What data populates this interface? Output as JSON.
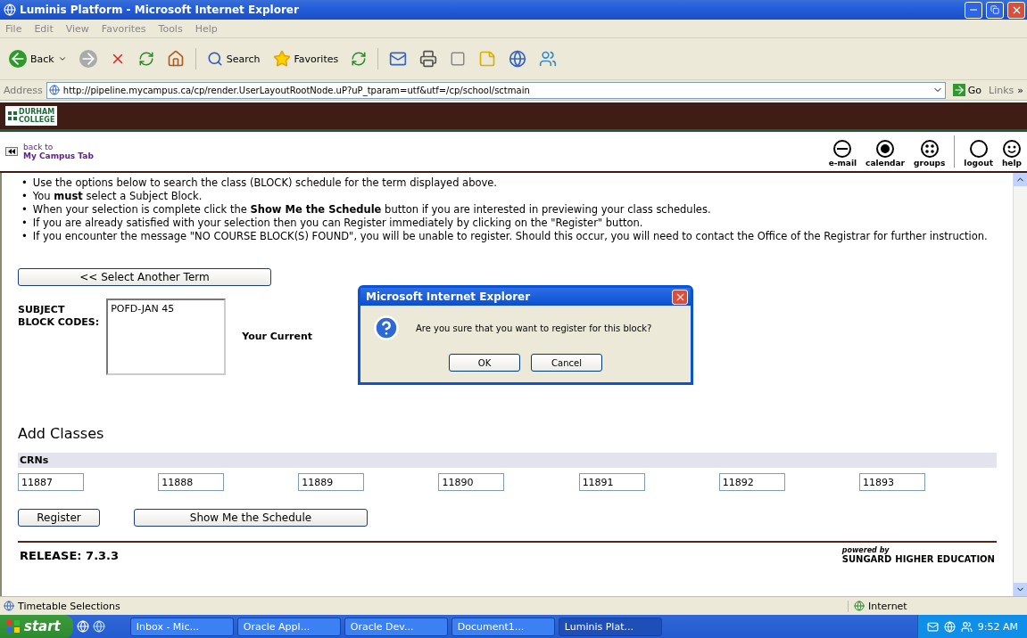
{
  "window": {
    "title": "Luminis Platform - Microsoft Internet Explorer"
  },
  "menu": [
    "File",
    "Edit",
    "View",
    "Favorites",
    "Tools",
    "Help"
  ],
  "toolbar": {
    "back": "Back",
    "search": "Search",
    "favorites": "Favorites"
  },
  "address": {
    "label": "Address",
    "url": "http://pipeline.mycampus.ca/cp/render.UserLayoutRootNode.uP?uP_tparam=utf&utf=/cp/school/sctmain",
    "go": "Go",
    "links": "Links",
    "more": "»"
  },
  "brand": {
    "logo_lines": [
      "DURHAM",
      "COLLEGE"
    ]
  },
  "portal_nav": {
    "back_line1": "back to",
    "back_line2": "My Campus Tab",
    "icons": [
      {
        "kind": "email",
        "label": "e-mail"
      },
      {
        "kind": "calendar",
        "label": "calendar"
      },
      {
        "kind": "groups",
        "label": "groups"
      },
      {
        "kind": "logout",
        "label": "logout"
      },
      {
        "kind": "help",
        "label": "help"
      }
    ]
  },
  "instruction_marker": "•",
  "instructions": [
    "Use the options below to search the class (BLOCK) schedule for the term displayed above.",
    "You **must** select a Subject Block.",
    "When your selection is complete click the **Show Me the Schedule** button if you are interested in previewing your class schedules.",
    "If you are already satisfied with your selection then you can Register immediately by clicking on the \"Register\" button.",
    "If you encounter the message \"NO COURSE BLOCK(S) FOUND\", you will be unable to register. Should this occur, you will need to contact the Office of the Registrar for further instruction."
  ],
  "select_term_button": "<< Select Another Term",
  "subject": {
    "label_line1": "SUBJECT",
    "label_line2": "BLOCK CODES:",
    "options": [
      {
        "label": "POFD-JAN 45",
        "selected": false
      }
    ],
    "current_label": "Your Current"
  },
  "add_classes": {
    "title": "Add Classes",
    "header": "CRNs",
    "crns": [
      "11887",
      "11888",
      "11889",
      "11890",
      "11891",
      "11892",
      "11893"
    ]
  },
  "buttons": {
    "register": "Register",
    "schedule": "Show Me the Schedule"
  },
  "footer": {
    "release": "RELEASE: 7.3.3",
    "powered_by": "powered by",
    "brand": "SUNGARD",
    "brand_suffix": "HIGHER EDUCATION"
  },
  "dialog": {
    "title": "Microsoft Internet Explorer",
    "message": "Are you sure that you want to register for this block?",
    "buttons": [
      "OK",
      "Cancel"
    ]
  },
  "status_bar": {
    "text": "Timetable Selections",
    "zone": "Internet"
  },
  "taskbar": {
    "start": "start",
    "tasks": [
      {
        "label": "Inbox - Mic...",
        "selected": false
      },
      {
        "label": "Oracle Appl...",
        "selected": false
      },
      {
        "label": "Oracle Dev...",
        "selected": false
      },
      {
        "label": "Document1...",
        "selected": false
      },
      {
        "label": "Luminis Plat...",
        "selected": true
      }
    ],
    "time": "9:52 AM"
  }
}
